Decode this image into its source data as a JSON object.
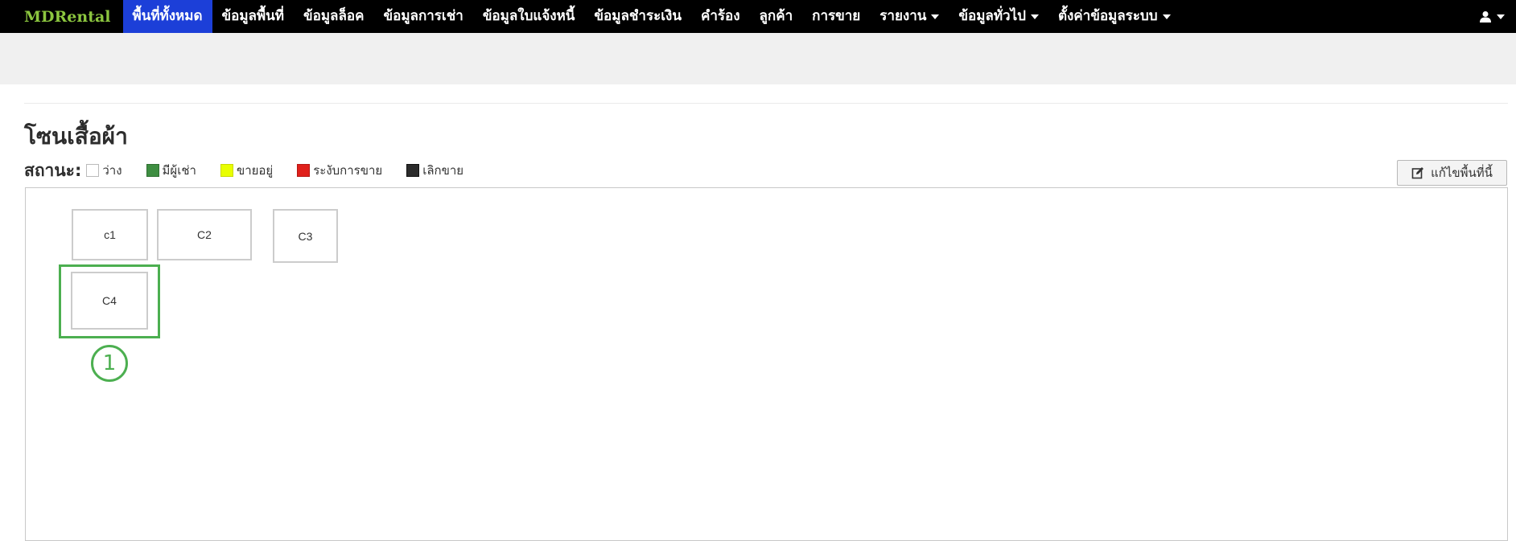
{
  "brand": {
    "name": "MDRental",
    "color": "#8cc63f"
  },
  "nav": {
    "items": [
      {
        "label": "พื้นที่ทั้งหมด",
        "active": true
      },
      {
        "label": "ข้อมูลพื้นที่"
      },
      {
        "label": "ข้อมูลล็อค"
      },
      {
        "label": "ข้อมูลการเช่า"
      },
      {
        "label": "ข้อมูลใบแจ้งหนี้"
      },
      {
        "label": "ข้อมูลชำระเงิน"
      },
      {
        "label": "คำร้อง"
      },
      {
        "label": "ลูกค้า"
      },
      {
        "label": "การขาย"
      },
      {
        "label": "รายงาน",
        "dropdown": true
      },
      {
        "label": "ข้อมูลทั่วไป",
        "dropdown": true
      },
      {
        "label": "ตั้งค่าข้อมูลระบบ",
        "dropdown": true
      }
    ],
    "active_color": "#1c3fd8",
    "user_icon": "user-icon"
  },
  "zone": {
    "title": "โซนเสื้อผ้า"
  },
  "status": {
    "label": "สถานะ:",
    "legend": [
      {
        "name": "ว่าง",
        "color": "#ffffff"
      },
      {
        "name": "มีผู้เช่า",
        "color": "#3e8e41"
      },
      {
        "name": "ขายอยู่",
        "color": "#e8ff00"
      },
      {
        "name": "ระงับการขาย",
        "color": "#e0201b"
      },
      {
        "name": "เลิกขาย",
        "color": "#2b2b2b"
      }
    ]
  },
  "edit_button": {
    "label": "แก้ไขพื้นที่นี้",
    "icon": "edit-icon"
  },
  "units": [
    {
      "name": "c1"
    },
    {
      "name": "C2"
    },
    {
      "name": "C3"
    },
    {
      "name": "C4"
    }
  ],
  "annotation": {
    "marker": "1",
    "color": "#4caf50"
  }
}
